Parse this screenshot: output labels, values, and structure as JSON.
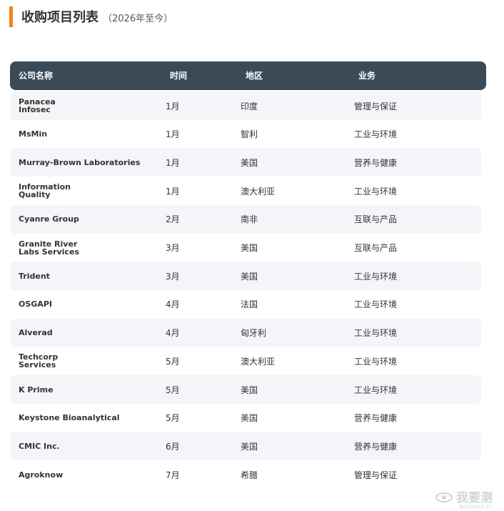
{
  "header": {
    "title": "收购项目列表",
    "subtitle": "（2026年至今）"
  },
  "table": {
    "columns": [
      "公司名称",
      "时间",
      "地区",
      "业务"
    ],
    "rows": [
      {
        "company": "Panacea\nInfosec",
        "time": "1月",
        "region": "印度",
        "business": "管理与保证"
      },
      {
        "company": "MsMin",
        "time": "1月",
        "region": "智利",
        "business": "工业与环境"
      },
      {
        "company": "Murray-Brown Laboratories",
        "time": "1月",
        "region": "美国",
        "business": "营养与健康"
      },
      {
        "company": "Information\nQuality",
        "time": "1月",
        "region": "澳大利亚",
        "business": "工业与环境"
      },
      {
        "company": "Cyanre Group",
        "time": "2月",
        "region": "南非",
        "business": "互联与产品"
      },
      {
        "company": "Granite River\nLabs Services",
        "time": "3月",
        "region": "美国",
        "business": "互联与产品"
      },
      {
        "company": "Trident",
        "time": "3月",
        "region": "美国",
        "business": "工业与环境"
      },
      {
        "company": "OSGAPI",
        "time": "4月",
        "region": "法国",
        "business": "工业与环境"
      },
      {
        "company": "Alverad",
        "time": "4月",
        "region": "匈牙利",
        "business": "工业与环境"
      },
      {
        "company": "Techcorp\nServices",
        "time": "5月",
        "region": "澳大利亚",
        "business": "工业与环境"
      },
      {
        "company": "K Prime",
        "time": "5月",
        "region": "美国",
        "business": "工业与环境"
      },
      {
        "company": "Keystone Bioanalytical",
        "time": "5月",
        "region": "美国",
        "business": "营养与健康"
      },
      {
        "company": "CMIC Inc.",
        "time": "6月",
        "region": "美国",
        "business": "营养与健康"
      },
      {
        "company": "Agroknow",
        "time": "7月",
        "region": "希腊",
        "business": "管理与保证"
      }
    ]
  },
  "watermark": {
    "text": "我要测",
    "sub": "woyaoce.cn"
  },
  "colors": {
    "accent": "#f7821b",
    "header_bg": "#3a4b57",
    "row_alt": "#f4f5f8"
  }
}
